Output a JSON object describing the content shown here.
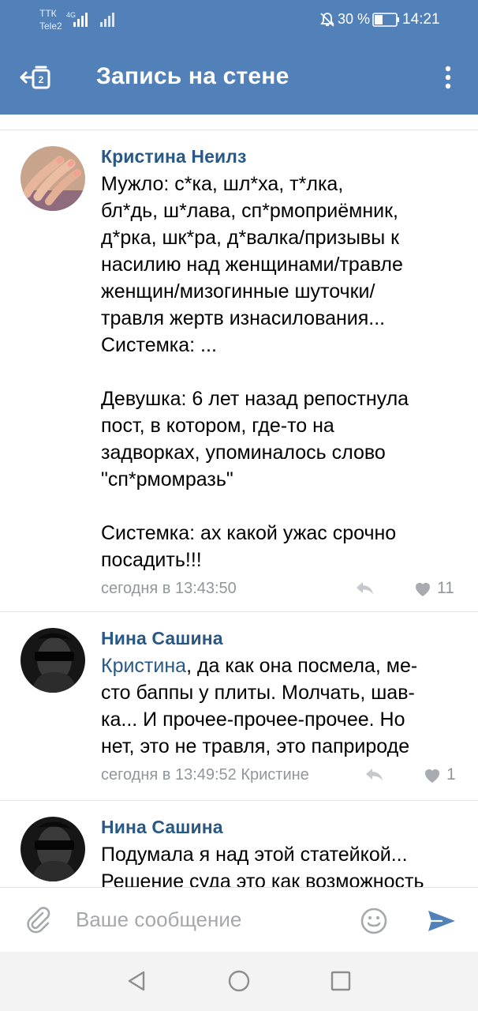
{
  "status_bar": {
    "carrier_1": "ТТК",
    "carrier_2": "Tele2",
    "network": "4G",
    "battery_percent": "30 %",
    "time": "14:21"
  },
  "app_bar": {
    "title": "Запись на стене",
    "back_icon": "back-arrow-icon",
    "menu_icon": "more-vertical-icon"
  },
  "comments": [
    {
      "author": "Кристина Неилз",
      "avatar": "manicure-hand-photo",
      "reply_to": "",
      "text_lines": [
        "Мужло: с*ка, шл*ха, т*лка,",
        "бл*дь, ш*лава, сп*рмоприёмник,",
        "д*рка, шк*ра, д*валка/призывы к",
        "насилию над женщинами/травле",
        "женщин/мизогинные шуточки/",
        "травля жертв изнасилования...",
        "Системка: ...",
        "",
        "Девушка: 6 лет назад репостнула",
        "пост, в котором, где-то на",
        "задворках, упоминалось слово",
        "\"сп*рмомразь\"",
        "",
        "Системка: ах какой ужас срочно",
        "посадить!!!"
      ],
      "time": "сегодня в 13:43:50",
      "likes": "11"
    },
    {
      "author": "Нина Сашина",
      "avatar": "woman-blindfold-photo",
      "reply_to": "Кристина",
      "first_line_rest": ", да как она посмела, ме-",
      "text_lines": [
        "сто баппы у плиты. Молчать, шав-",
        "ка... И прочее-прочее-прочее. Но",
        "нет, это не травля, это паприроде"
      ],
      "time": "сегодня в 13:49:52 Кристине",
      "likes": "1"
    },
    {
      "author": "Нина Сашина",
      "avatar": "woman-blindfold-photo",
      "text_lines": [
        "Подумала я над этой статейкой...",
        "Решение суда это как возможность"
      ]
    }
  ],
  "composer": {
    "placeholder": "Ваше сообщение"
  },
  "colors": {
    "brand": "#5181b8",
    "link": "#2a5885",
    "meta": "#939699"
  }
}
